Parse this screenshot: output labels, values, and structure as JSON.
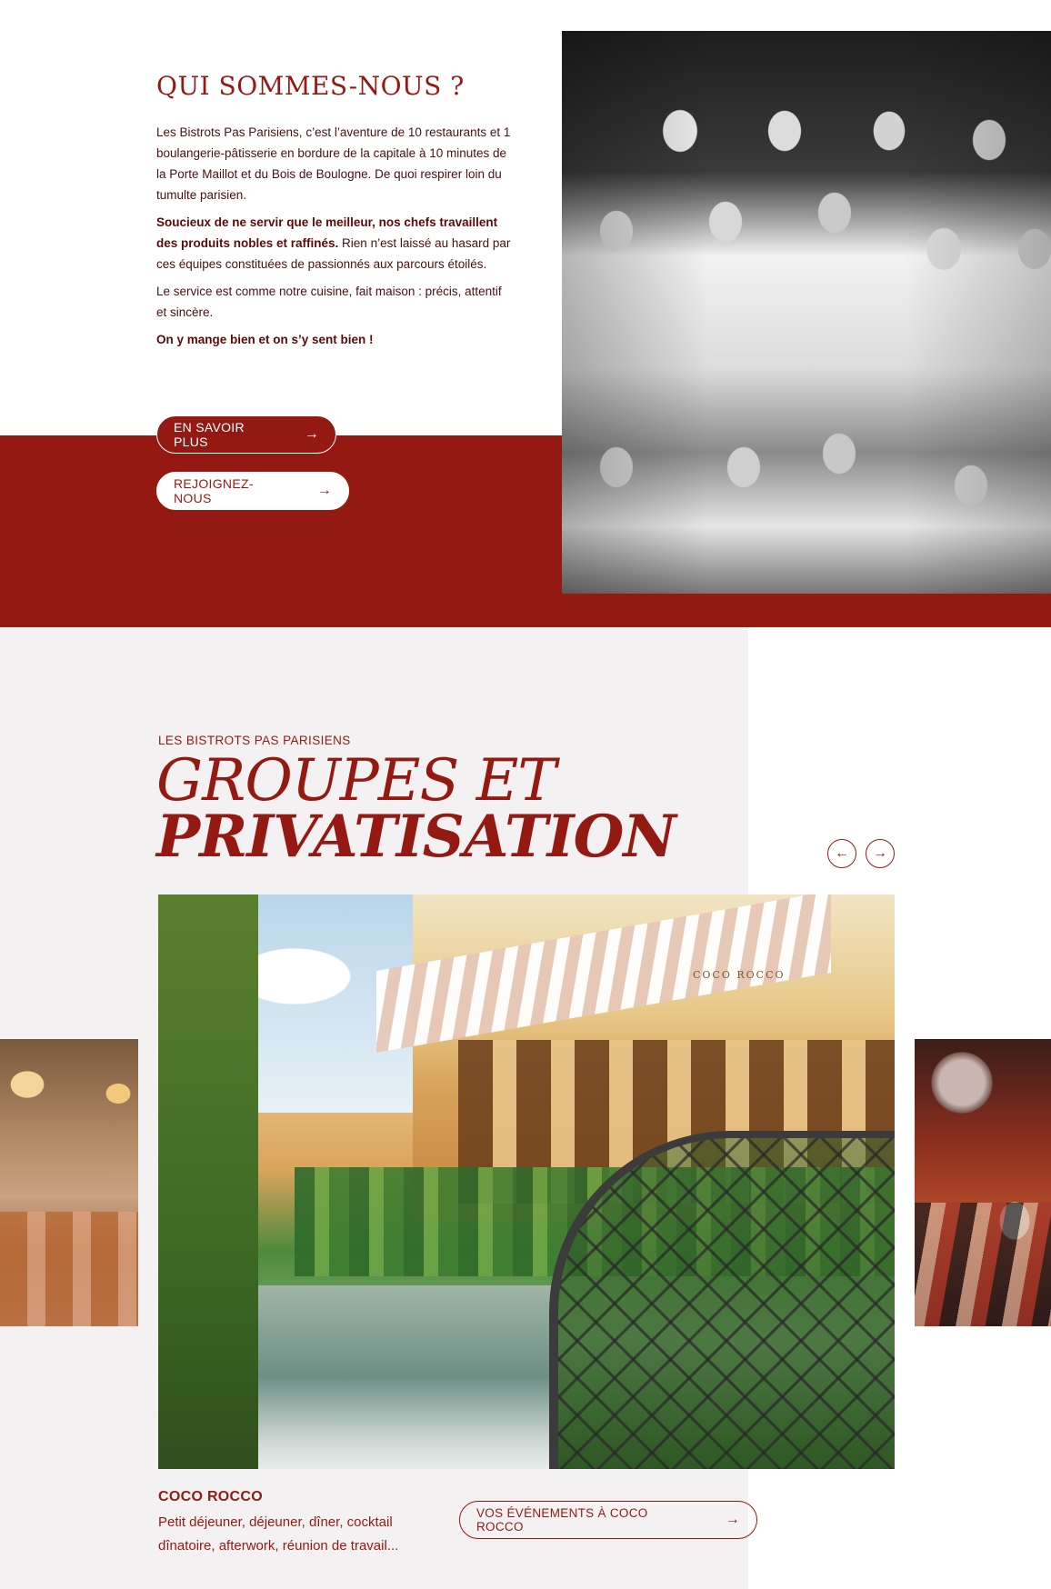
{
  "about": {
    "title": "QUI SOMMES-NOUS ?",
    "paragraph1": "Les Bistrots Pas Parisiens, c’est l’aventure de 10 restaurants et 1 boulangerie-pâtisserie en bordure de la capitale à 10 minutes de la Porte Maillot et du Bois de Boulogne. De quoi respirer loin du tumulte parisien.",
    "paragraph2_bold": "Soucieux de ne servir que le meilleur, nos chefs travaillent des produits nobles et raffinés.",
    "paragraph2_rest": " Rien n’est laissé au hasard par ces équipes constituées de passionnés aux parcours étoilés.",
    "paragraph3": "Le service est comme notre cuisine, fait maison : précis, attentif et sincère.",
    "paragraph4_bold": "On y mange bien et on s’y sent bien !",
    "btn_savoir": "EN SAVOIR PLUS",
    "btn_rejoignez": "REJOIGNEZ-NOUS",
    "arrow_glyph": "→"
  },
  "groupes": {
    "eyebrow": "LES BISTROTS PAS PARISIENS",
    "title_line1": "GROUPES ET",
    "title_line2": "PRIVATISATION",
    "prev_glyph": "←",
    "next_glyph": "→",
    "sign_text": "COCO ROCCO",
    "venue_name": "COCO ROCCO",
    "venue_desc": "Petit déjeuner, déjeuner, dîner, cocktail dînatoire, afterwork, réunion de travail...",
    "btn_events": "VOS ÉVÉNEMENTS À COCO ROCCO",
    "arrow_glyph": "→"
  },
  "colors": {
    "brand_red": "#941913",
    "section_gray": "#f3f1f1",
    "text_dark_red": "#4a1010"
  },
  "icons": {
    "arrow_right": "arrow-right-icon",
    "arrow_left": "arrow-left-icon"
  }
}
